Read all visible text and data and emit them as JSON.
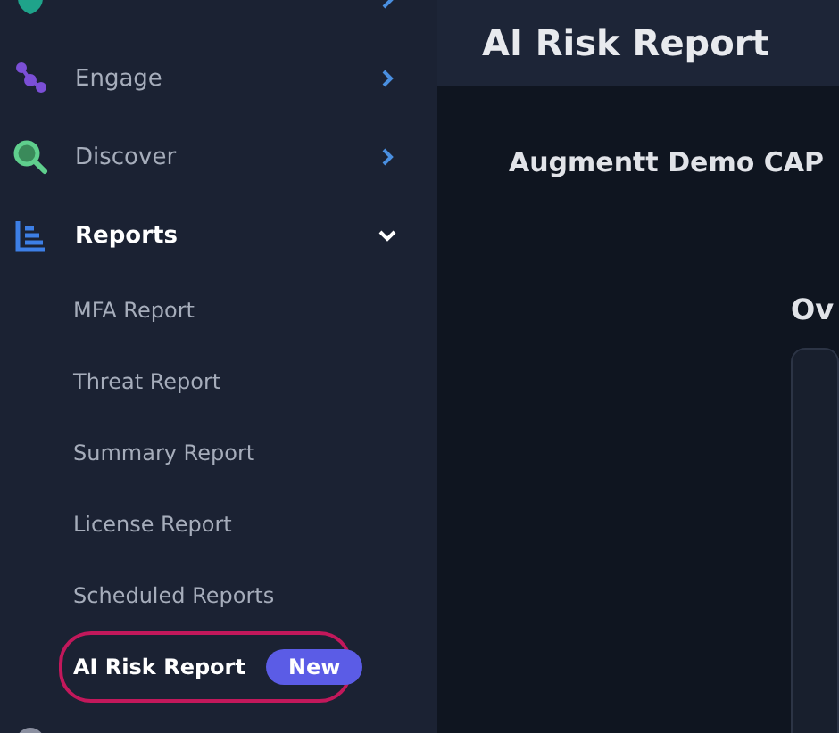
{
  "sidebar": {
    "items": [
      {
        "kind": "partial"
      },
      {
        "kind": "group",
        "label": "Engage",
        "expanded": false
      },
      {
        "kind": "group",
        "label": "Discover",
        "expanded": false
      },
      {
        "kind": "group",
        "label": "Reports",
        "expanded": true,
        "children": [
          {
            "label": "MFA Report",
            "selected": false
          },
          {
            "label": "Threat Report",
            "selected": false
          },
          {
            "label": "Summary Report",
            "selected": false
          },
          {
            "label": "License Report",
            "selected": false
          },
          {
            "label": "Scheduled Reports",
            "selected": false
          },
          {
            "label": "AI Risk Report",
            "selected": true,
            "badge": "New"
          }
        ]
      },
      {
        "kind": "partial"
      }
    ]
  },
  "header": {
    "title": "AI Risk Report"
  },
  "content": {
    "company": "Augmentt Demo CAP",
    "section_title": "Ov"
  }
}
